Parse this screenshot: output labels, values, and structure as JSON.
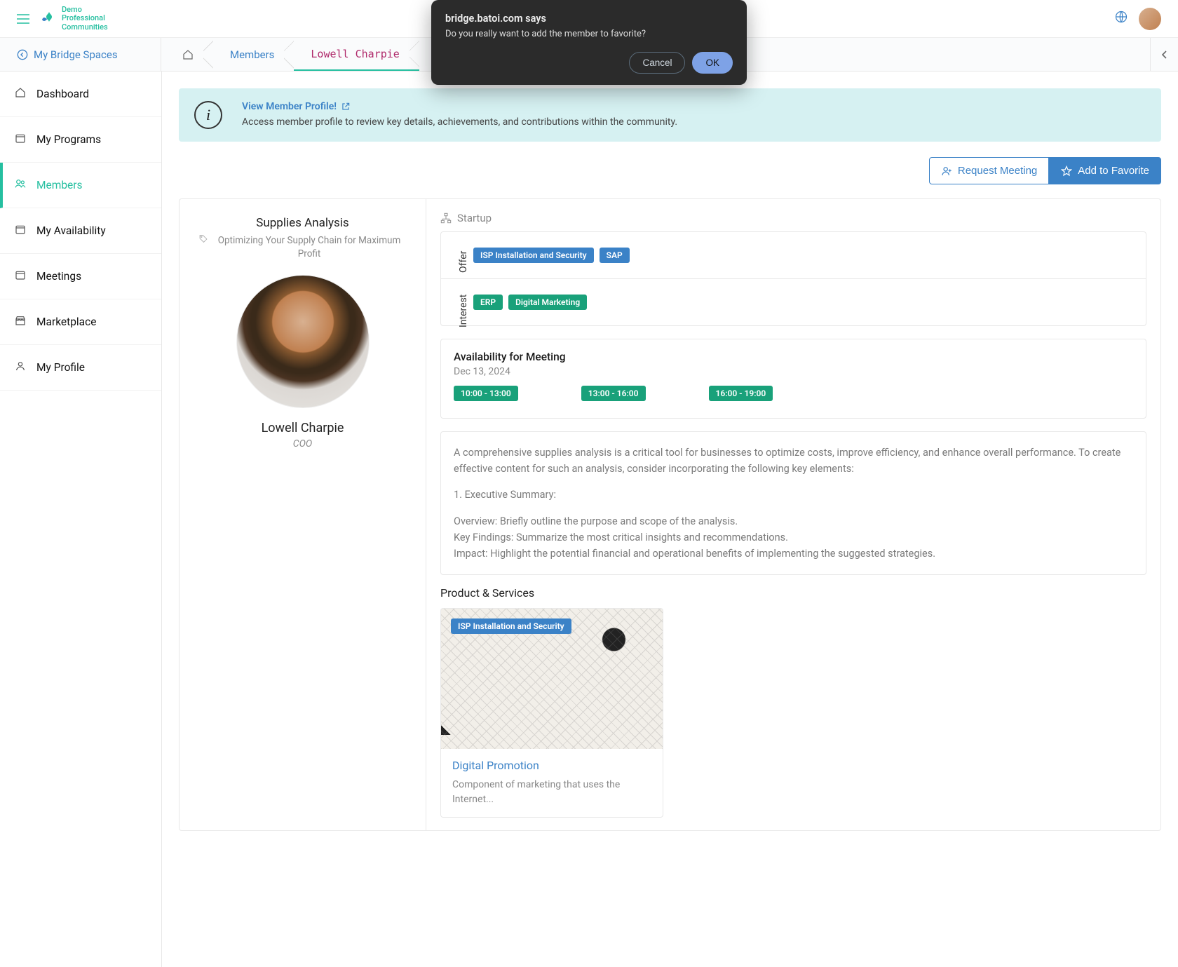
{
  "brand": {
    "line1": "Demo",
    "line2": "Professional",
    "line3": "Communities"
  },
  "dialog": {
    "title": "bridge.batoi.com says",
    "message": "Do you really want to add the member to favorite?",
    "cancel": "Cancel",
    "ok": "OK"
  },
  "crumbs": {
    "back": "My Bridge Spaces",
    "members": "Members",
    "active": "Lowell Charpie"
  },
  "sidebar": {
    "dashboard": "Dashboard",
    "programs": "My Programs",
    "members": "Members",
    "availability": "My Availability",
    "meetings": "Meetings",
    "marketplace": "Marketplace",
    "profile": "My Profile"
  },
  "banner": {
    "title": "View Member Profile!",
    "sub": "Access member profile to review key details, achievements, and contributions within the community."
  },
  "actions": {
    "request_meeting": "Request Meeting",
    "add_favorite": "Add to Favorite"
  },
  "profile": {
    "section": "Supplies Analysis",
    "tagline": "Optimizing Your Supply Chain for Maximum Profit",
    "name": "Lowell Charpie",
    "role": "COO"
  },
  "startup_label": "Startup",
  "labels": {
    "offer": "Offer",
    "interest": "Interest"
  },
  "offer": [
    "ISP Installation and Security",
    "SAP"
  ],
  "interest": [
    "ERP",
    "Digital Marketing"
  ],
  "availability": {
    "title": "Availability for Meeting",
    "date": "Dec 13, 2024",
    "slots": [
      "10:00 - 13:00",
      "13:00 - 16:00",
      "16:00 - 19:00"
    ]
  },
  "description": {
    "p1": "A comprehensive supplies analysis is a critical tool for businesses to optimize costs, improve efficiency, and enhance overall performance. To create effective content for such an analysis, consider incorporating the following key elements:",
    "p2": "1. Executive Summary:",
    "p3a": "Overview: Briefly outline the purpose and scope of the analysis.",
    "p3b": "Key Findings: Summarize the most critical insights and recommendations.",
    "p3c": "Impact: Highlight the potential financial and operational benefits of implementing the suggested strategies."
  },
  "products": {
    "heading": "Product & Services",
    "card": {
      "tag": "ISP Installation and Security",
      "title": "Digital Promotion",
      "desc": "Component of marketing that uses the Internet..."
    }
  }
}
